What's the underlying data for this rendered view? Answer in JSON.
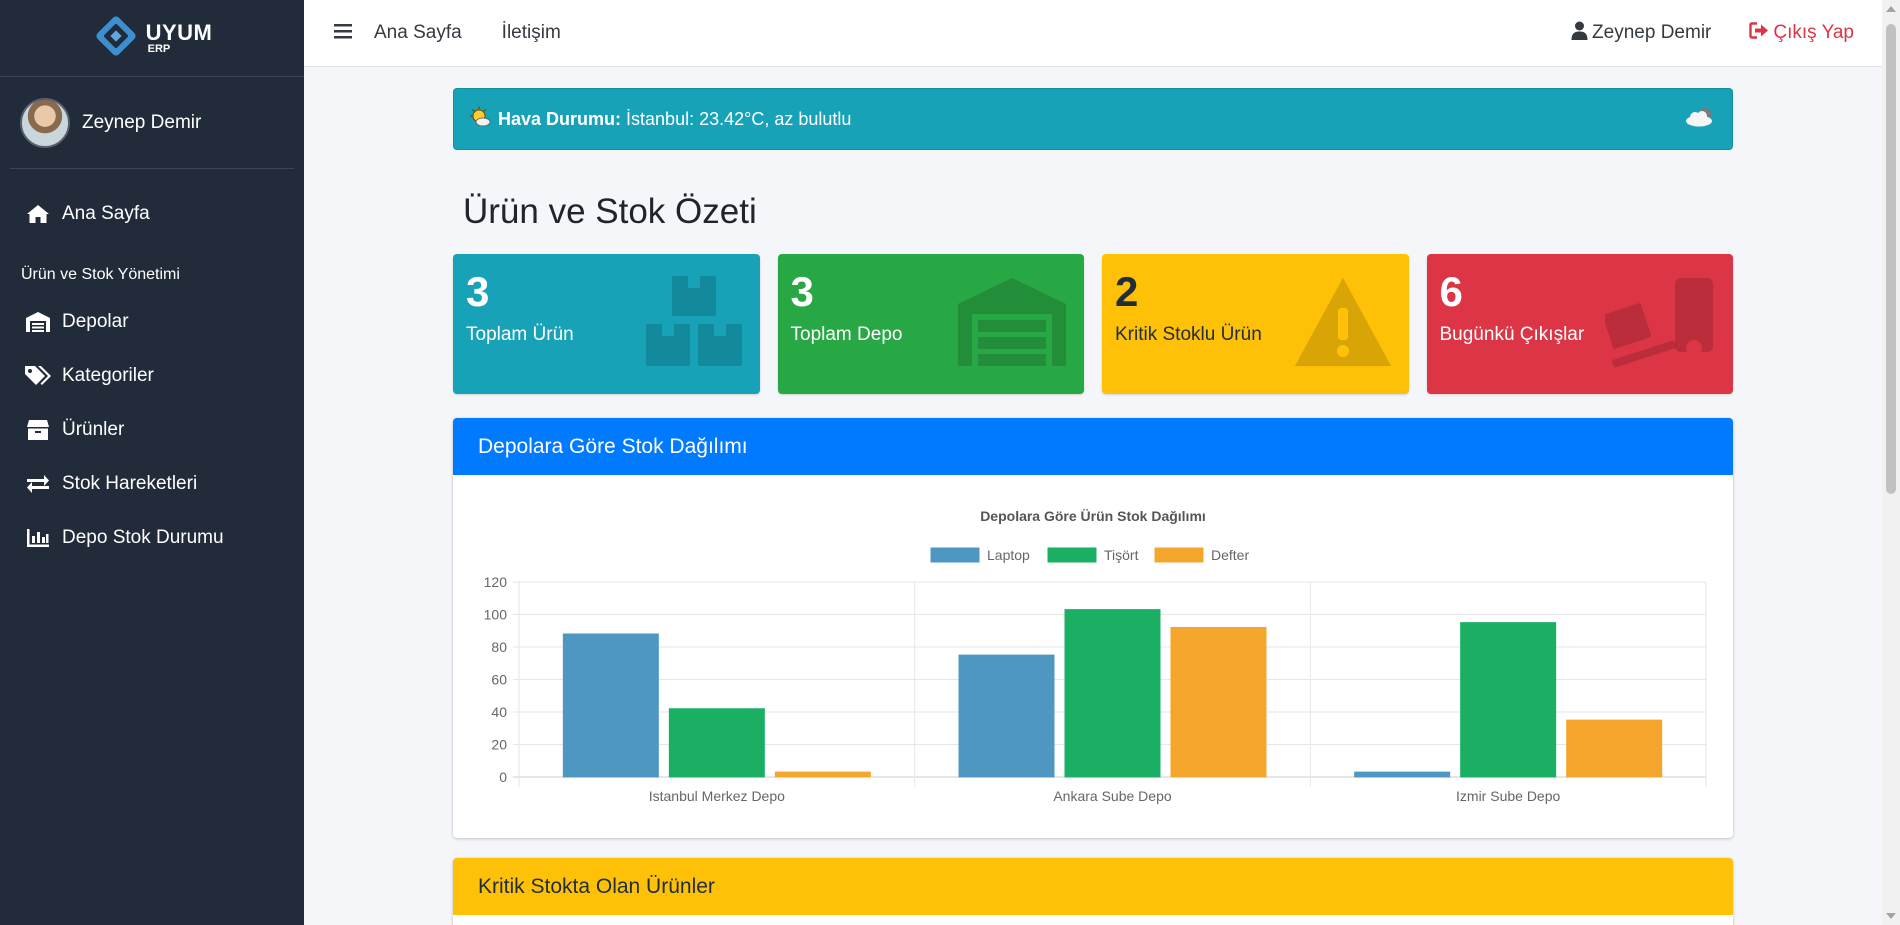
{
  "brand": {
    "name": "UYUM",
    "sub": "ERP"
  },
  "user": {
    "name": "Zeynep Demir"
  },
  "sidebar": {
    "home": "Ana Sayfa",
    "section_header": "Ürün ve Stok Yönetimi",
    "items": [
      {
        "label": "Depolar",
        "icon": "warehouse-icon"
      },
      {
        "label": "Kategoriler",
        "icon": "tags-icon"
      },
      {
        "label": "Ürünler",
        "icon": "box-icon"
      },
      {
        "label": "Stok Hareketleri",
        "icon": "exchange-icon"
      },
      {
        "label": "Depo Stok Durumu",
        "icon": "bar-chart-icon"
      }
    ]
  },
  "topbar": {
    "links": [
      "Ana Sayfa",
      "İletişim"
    ],
    "user": "Zeynep Demir",
    "logout": "Çıkış Yap"
  },
  "weather": {
    "label": "Hava Durumu:",
    "text": "İstanbul: 23.42°C, az bulutlu"
  },
  "page_title": "Ürün ve Stok Özeti",
  "stats": [
    {
      "value": "3",
      "label": "Toplam Ürün",
      "icon": "boxes-icon",
      "color": "#17a2b8"
    },
    {
      "value": "3",
      "label": "Toplam Depo",
      "icon": "warehouse-icon",
      "color": "#28a745"
    },
    {
      "value": "2",
      "label": "Kritik Stoklu Ürün",
      "icon": "warning-icon",
      "color": "#ffc107"
    },
    {
      "value": "6",
      "label": "Bugünkü Çıkışlar",
      "icon": "dolly-icon",
      "color": "#dc3545"
    }
  ],
  "stock_card": {
    "title": "Depolara Göre Stok Dağılımı"
  },
  "critical_card": {
    "title": "Kritik Stokta Olan Ürünler"
  },
  "chart_data": {
    "type": "bar",
    "title": "Depolara Göre Ürün Stok Dağılımı",
    "categories": [
      "Istanbul Merkez Depo",
      "Ankara Sube Depo",
      "Izmir Sube Depo"
    ],
    "series": [
      {
        "name": "Laptop",
        "values": [
          88,
          75,
          3
        ],
        "color": "#4f97c3"
      },
      {
        "name": "Tişört",
        "values": [
          42,
          103,
          95
        ],
        "color": "#1aaf63"
      },
      {
        "name": "Defter",
        "values": [
          3,
          92,
          35
        ],
        "color": "#f4a52c"
      }
    ],
    "ylim": [
      0,
      120
    ],
    "yticks": [
      0,
      20,
      40,
      60,
      80,
      100,
      120
    ],
    "grid": true,
    "legend": "top-center"
  }
}
